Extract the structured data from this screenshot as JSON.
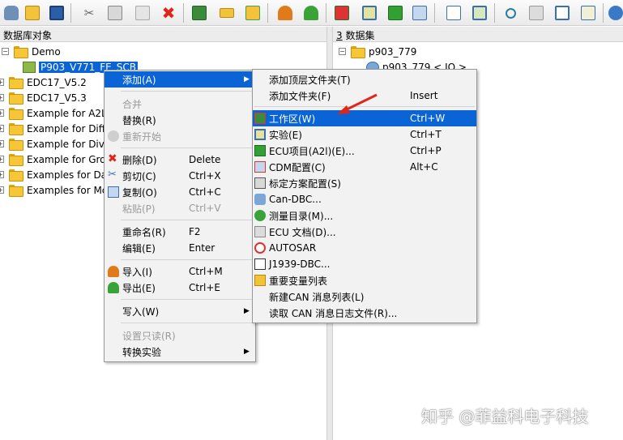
{
  "toolbar": {
    "buttons": [
      "database-icon",
      "open-folder-icon",
      "save-icon",
      "cut-icon",
      "copy-icon",
      "paste-icon",
      "delete-icon",
      "workspace-icon",
      "hierarchy-icon",
      "add-tree-icon",
      "import-icon",
      "export-icon",
      "flag-icon",
      "measure-icon",
      "ecu-icon",
      "compare-icon",
      "checklist-icon",
      "edit-window-icon",
      "search-icon",
      "copy-doc-icon",
      "split-icon",
      "report-icon",
      "globe-icon"
    ]
  },
  "left_pane": {
    "header": "数据库对象",
    "tree": [
      {
        "label": "Demo",
        "expander": "−"
      },
      {
        "label": "P903_V771_FE_SCB",
        "selected": true
      },
      {
        "label": "EDC17_V5.2",
        "expander": "+"
      },
      {
        "label": "EDC17_V5.3",
        "expander": "+"
      },
      {
        "label": "Example for A2L",
        "expander": "+"
      },
      {
        "label": "Example for Diff",
        "expander": "+"
      },
      {
        "label": "Example for Dive",
        "expander": "+"
      },
      {
        "label": "Example for Gro",
        "expander": "+"
      },
      {
        "label": "Examples for Da",
        "expander": "+"
      },
      {
        "label": "Examples for Mc",
        "expander": "+"
      }
    ]
  },
  "right_pane": {
    "header_num": "3",
    "header": "数据集",
    "tree": [
      {
        "label": "p903_779",
        "expander": "−"
      },
      {
        "label": "p903_779 < IO >"
      }
    ]
  },
  "context_menu": {
    "items": [
      {
        "label": "添加(A)",
        "shortcut": "",
        "submenu": true,
        "highlighted": true
      },
      {
        "label": "合并",
        "shortcut": "",
        "disabled": true
      },
      {
        "label": "替换(R)",
        "shortcut": ""
      },
      {
        "label": "重新开始",
        "shortcut": "",
        "disabled": true
      },
      {
        "label": "删除(D)",
        "shortcut": "Delete"
      },
      {
        "label": "剪切(C)",
        "shortcut": "Ctrl+X"
      },
      {
        "label": "复制(O)",
        "shortcut": "Ctrl+C"
      },
      {
        "label": "粘贴(P)",
        "shortcut": "Ctrl+V",
        "disabled": true
      },
      {
        "label": "重命名(R)",
        "shortcut": "F2"
      },
      {
        "label": "编辑(E)",
        "shortcut": "Enter"
      },
      {
        "label": "导入(I)",
        "shortcut": "Ctrl+M"
      },
      {
        "label": "导出(E)",
        "shortcut": "Ctrl+E"
      },
      {
        "label": "写入(W)",
        "shortcut": "",
        "submenu": true
      },
      {
        "label": "设置只读(R)",
        "shortcut": "",
        "disabled": true
      },
      {
        "label": "转换实验",
        "shortcut": "",
        "submenu": true
      }
    ]
  },
  "submenu": {
    "items": [
      {
        "label": "添加顶层文件夹(T)",
        "shortcut": ""
      },
      {
        "label": "添加文件夹(F)",
        "shortcut": "Insert"
      },
      {
        "label": "工作区(W)",
        "shortcut": "Ctrl+W",
        "highlighted": true
      },
      {
        "label": "实验(E)",
        "shortcut": "Ctrl+T"
      },
      {
        "label": "ECU项目(A2l)(E)...",
        "shortcut": "Ctrl+P"
      },
      {
        "label": "CDM配置(C)",
        "shortcut": "Alt+C"
      },
      {
        "label": "标定方案配置(S)",
        "shortcut": ""
      },
      {
        "label": "Can-DBC...",
        "shortcut": ""
      },
      {
        "label": "测量目录(M)...",
        "shortcut": ""
      },
      {
        "label": "ECU 文档(D)...",
        "shortcut": ""
      },
      {
        "label": "AUTOSAR",
        "shortcut": ""
      },
      {
        "label": "J1939-DBC...",
        "shortcut": ""
      },
      {
        "label": "重要变量列表",
        "shortcut": ""
      },
      {
        "label": "新建CAN 消息列表(L)",
        "shortcut": ""
      },
      {
        "label": "读取 CAN 消息日志文件(R)...",
        "shortcut": ""
      }
    ]
  },
  "watermark": "知乎 @菲益科电子科技",
  "colors": {
    "highlight": "#0a64d6",
    "annotation_arrow": "#e0261b"
  }
}
